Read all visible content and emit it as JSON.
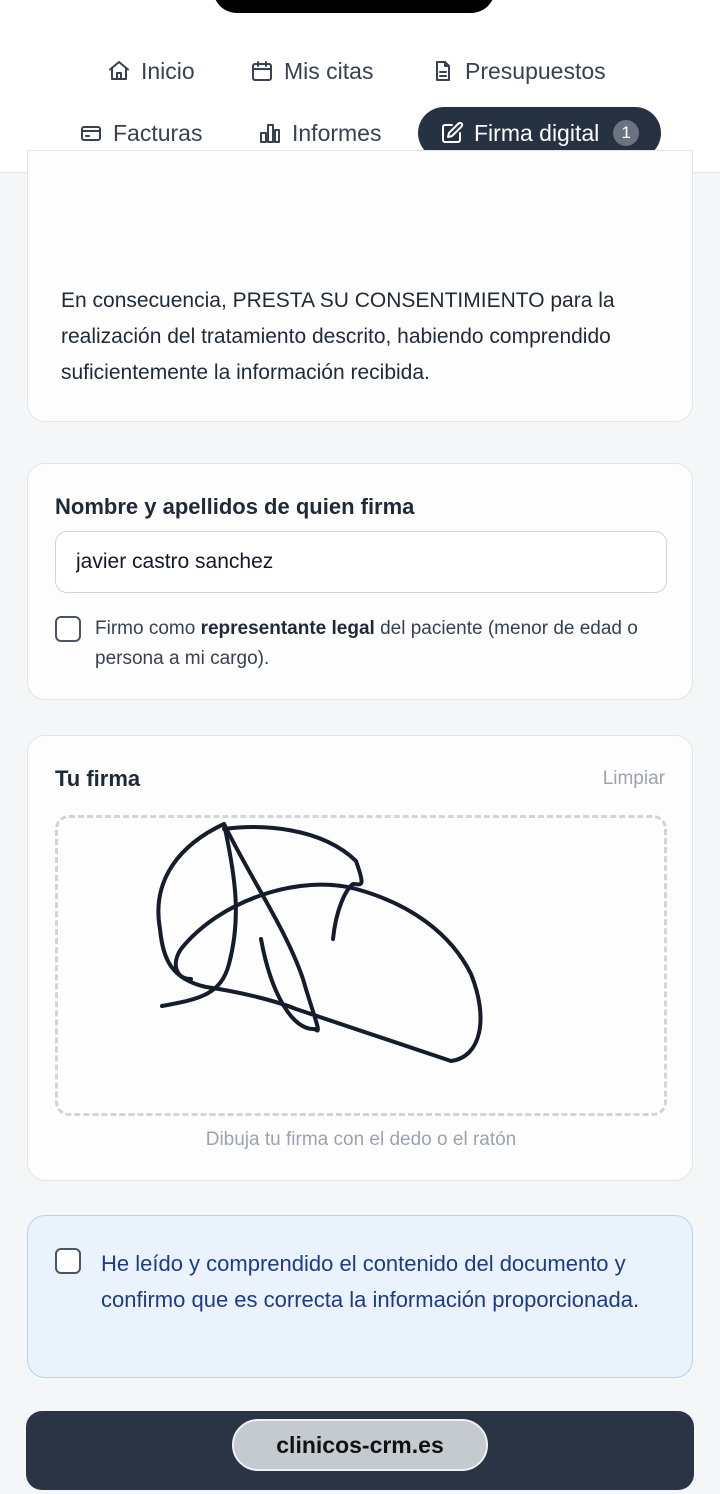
{
  "nav": {
    "items": [
      {
        "label": "Inicio",
        "icon": "home-icon"
      },
      {
        "label": "Mis citas",
        "icon": "calendar-icon"
      },
      {
        "label": "Presupuestos",
        "icon": "document-icon"
      },
      {
        "label": "Facturas",
        "icon": "card-icon"
      },
      {
        "label": "Informes",
        "icon": "bar-chart-icon"
      },
      {
        "label": "Firma digital",
        "icon": "pen-square-icon",
        "active": true,
        "badge": "1"
      }
    ]
  },
  "consent": {
    "text": "En consecuencia, PRESTA SU CONSENTIMIENTO para la realización del tratamiento descrito, habiendo comprendido suficientemente la información recibida."
  },
  "signer": {
    "label": "Nombre y apellidos de quien firma",
    "value": "javier castro sanchez",
    "legal_rep_prefix": "Firmo como ",
    "legal_rep_bold": "representante legal",
    "legal_rep_suffix": " del paciente (menor de edad o persona a mi cargo).",
    "legal_rep_checked": false
  },
  "signature": {
    "title": "Tu firma",
    "clear_label": "Limpiar",
    "hint": "Dibuja tu firma con el dedo o el ratón"
  },
  "confirm": {
    "text": "He leído y comprendido el contenido del documento y confirmo que es correcta la información proporcionada.",
    "checked": false
  },
  "browser": {
    "url": "clinicos-crm.es"
  },
  "colors": {
    "active_nav": "#263142",
    "confirm_bg": "#eaf2fb",
    "confirm_text": "#1e3a8a",
    "submit_bar": "#2a3445"
  }
}
